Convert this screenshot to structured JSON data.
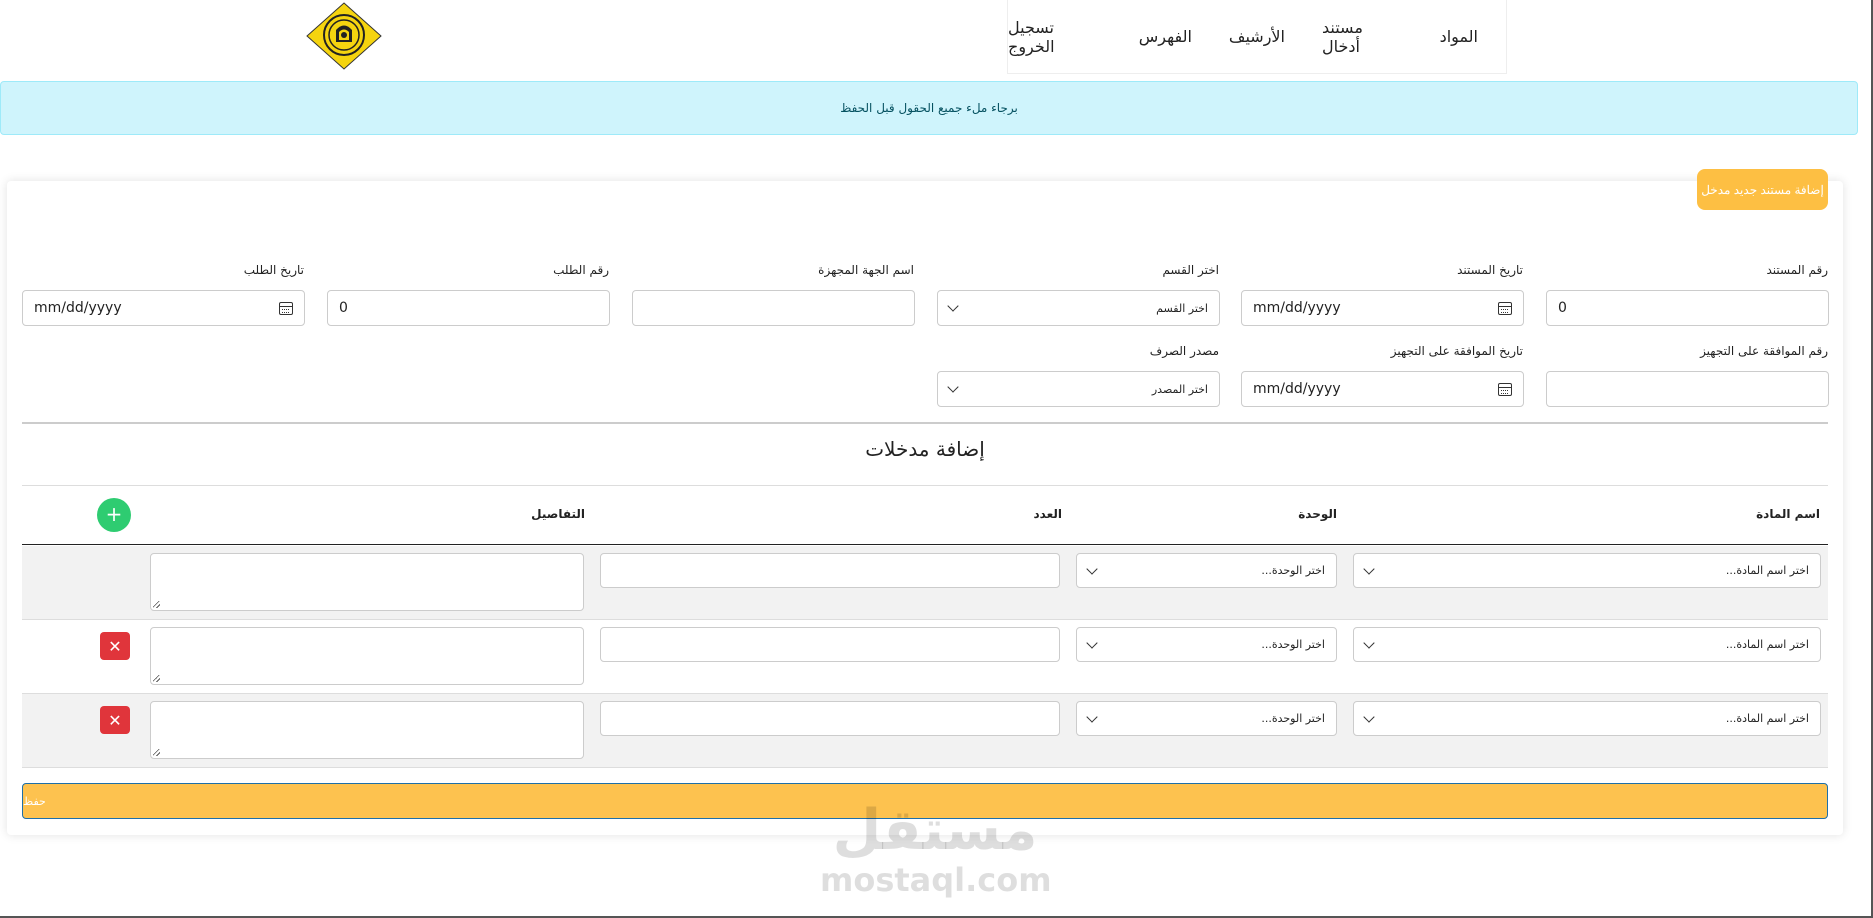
{
  "nav": {
    "items": [
      {
        "label": "المواد"
      },
      {
        "label": "مستند أدخال"
      },
      {
        "label": "الأرشيف"
      },
      {
        "label": "الفهرس"
      },
      {
        "label": "تسجيل الخروج"
      }
    ]
  },
  "alert": {
    "text": "برجاء ملء جميع الحقول قبل الحفظ"
  },
  "card": {
    "add_button": "إضافة مستند جديد مدخل",
    "fields": {
      "doc_number": {
        "label": "رقم المستند",
        "value": "0"
      },
      "doc_date": {
        "label": "تاريخ المستند",
        "value": "mm/dd/yyyy"
      },
      "department": {
        "label": "اختر القسم",
        "value": "اختر القسم"
      },
      "supplier_name": {
        "label": "اسم الجهة المجهزة",
        "value": ""
      },
      "request_number": {
        "label": "رقم الطلب",
        "value": "0"
      },
      "request_date": {
        "label": "تاريخ الطلب",
        "value": "mm/dd/yyyy"
      },
      "approval_number": {
        "label": "رقم الموافقة على التجهيز",
        "value": ""
      },
      "approval_date": {
        "label": "تاريخ الموافقة على التجهيز",
        "value": "mm/dd/yyyy"
      },
      "expense_source": {
        "label": "مصدر الصرف",
        "value": "اختر المصدر"
      }
    },
    "entries": {
      "title": "إضافة مدخلات",
      "columns": {
        "material": "اسم المادة",
        "unit": "الوحدة",
        "count": "العدد",
        "details": "التفاصيل"
      },
      "add_row": "+",
      "rows": [
        {
          "material": "اختر اسم المادة...",
          "unit": "اختر الوحدة...",
          "count": "",
          "details": ""
        },
        {
          "material": "اختر اسم المادة...",
          "unit": "اختر الوحدة...",
          "count": "",
          "details": ""
        },
        {
          "material": "اختر اسم المادة...",
          "unit": "اختر الوحدة...",
          "count": "",
          "details": ""
        }
      ],
      "delete_label": "✕"
    },
    "save_button": "حفظ"
  },
  "watermark": {
    "ar": "مستقل",
    "en": "mostaql.com"
  },
  "colors": {
    "accent": "#fdbf43",
    "alert_bg": "#cff4fc",
    "add_row": "#2ecc71",
    "delete": "#e0353b"
  }
}
